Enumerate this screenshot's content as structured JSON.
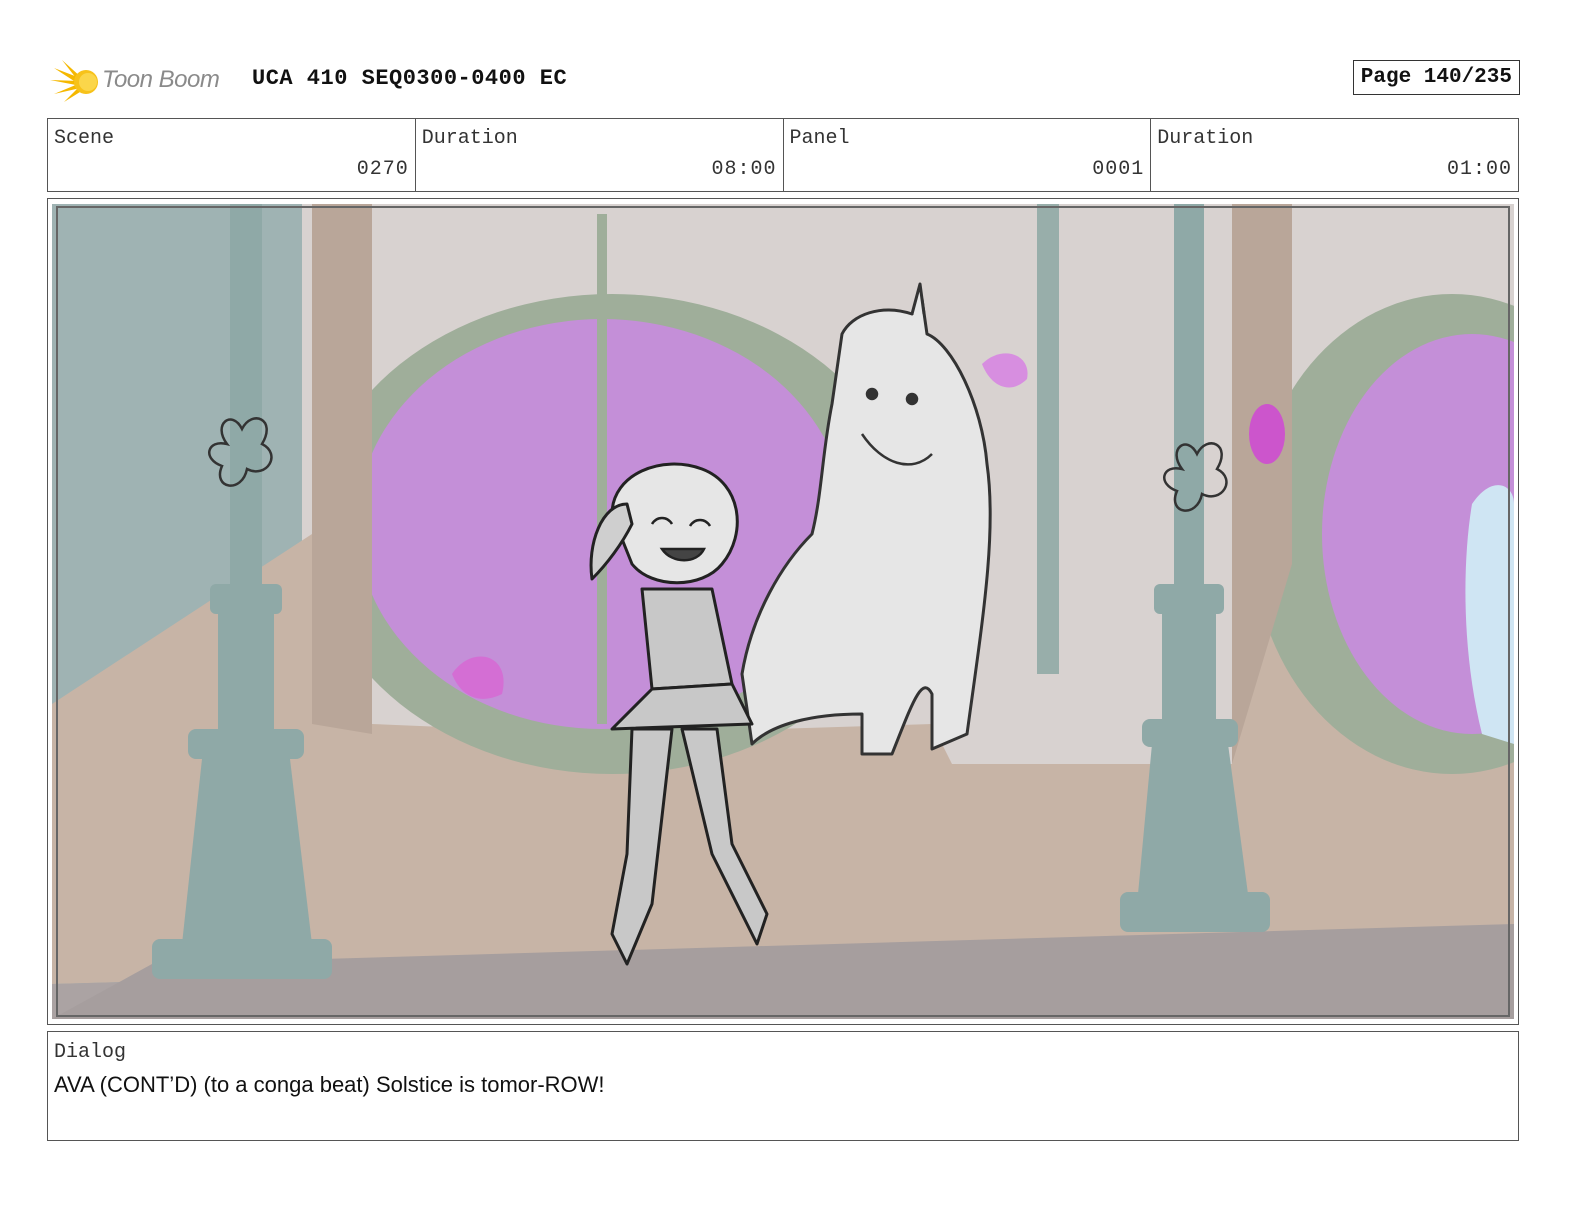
{
  "header": {
    "logo_text": "Toon Boom",
    "document_title": "UCA 410 SEQ0300-0400 EC",
    "page_indicator": "Page 140/235"
  },
  "info": {
    "scene_label": "Scene",
    "scene_value": "0270",
    "scene_duration_label": "Duration",
    "scene_duration_value": "08:00",
    "panel_label": "Panel",
    "panel_value": "0001",
    "panel_duration_label": "Duration",
    "panel_duration_value": "01:00"
  },
  "dialog": {
    "label": "Dialog",
    "text": "AVA (CONT’D) (to a conga beat) Solstice is tomor-ROW!"
  },
  "colors": {
    "window_glass": "#c48fd8",
    "window_frame": "#9fae9a",
    "pillar": "#8fa9a7",
    "wall": "#c7b4a6",
    "floor": "#aba3a3",
    "logo_orange": "#f5b800"
  }
}
